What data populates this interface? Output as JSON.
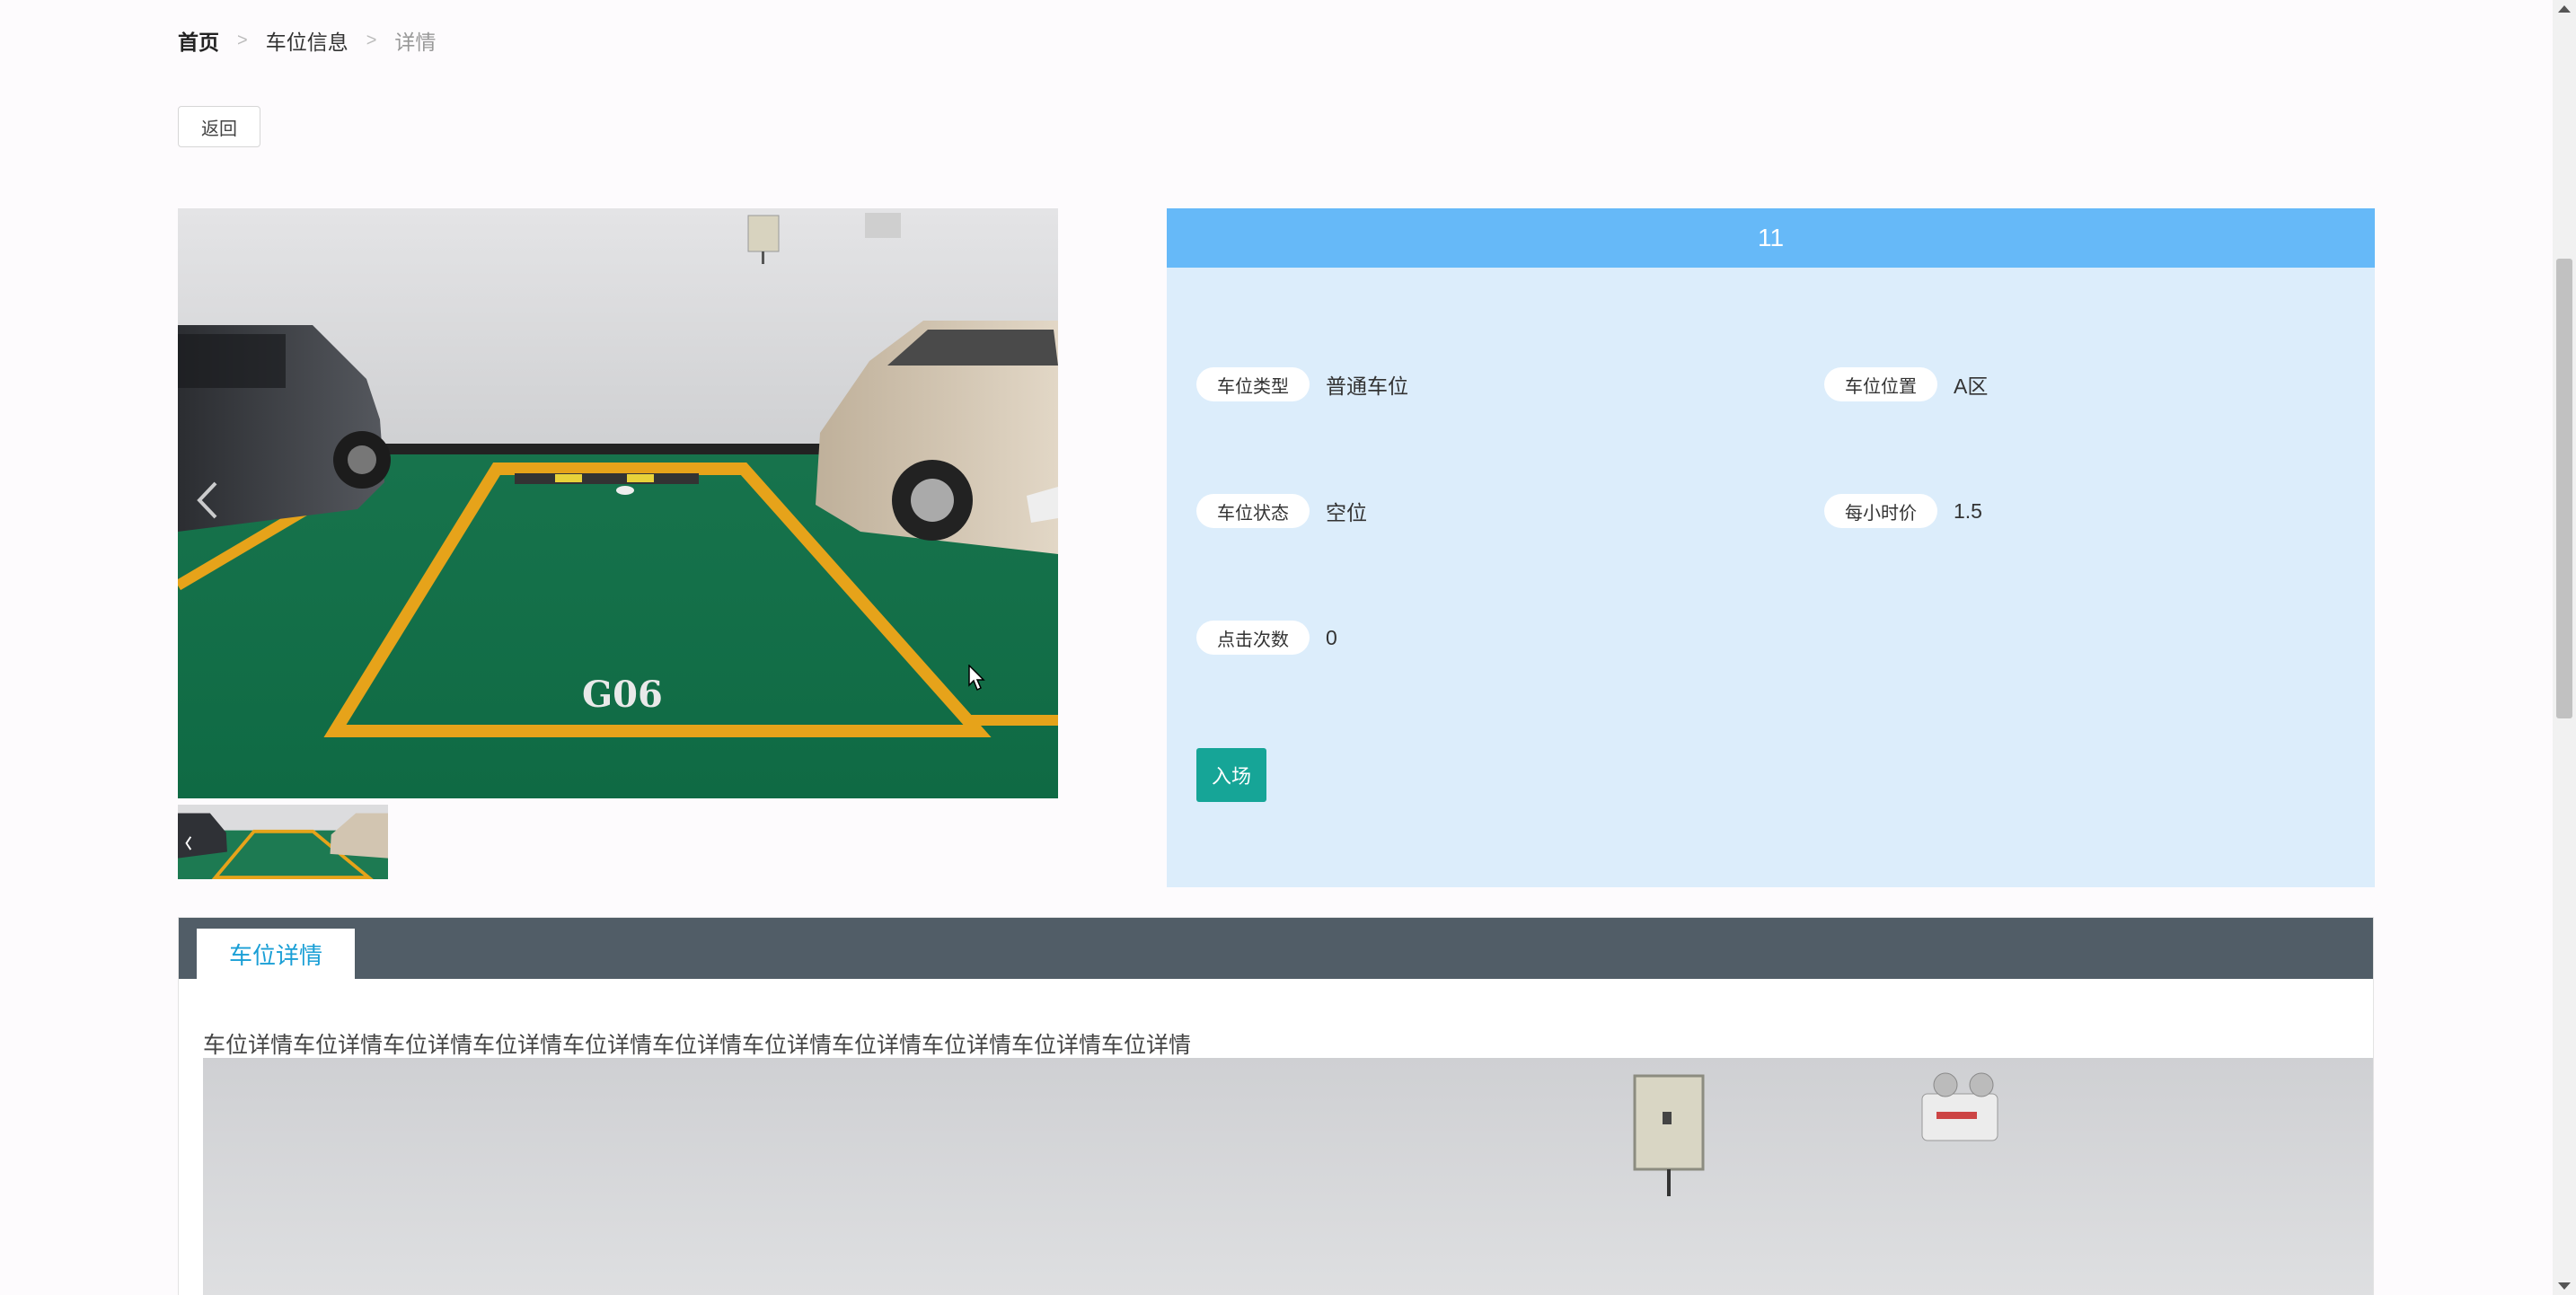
{
  "breadcrumb": {
    "home": "首页",
    "section": "车位信息",
    "current": "详情",
    "separator": ">"
  },
  "toolbar": {
    "back_label": "返回"
  },
  "gallery": {
    "main_image": "parking-space-photo",
    "thumbnail_image": "parking-space-thumbnail",
    "space_marking": "G06"
  },
  "info": {
    "title": "11",
    "fields": [
      {
        "label": "车位类型",
        "value": "普通车位"
      },
      {
        "label": "车位位置",
        "value": "A区"
      },
      {
        "label": "车位状态",
        "value": "空位"
      },
      {
        "label": "每小时价",
        "value": "1.5"
      },
      {
        "label": "点击次数",
        "value": "0"
      }
    ],
    "enter_label": "入场"
  },
  "details": {
    "tab_label": "车位详情",
    "text": "车位详情车位详情车位详情车位详情车位详情车位详情车位详情车位详情车位详情车位详情车位详情"
  },
  "colors": {
    "header_blue": "#66b9f8",
    "panel_bg": "#dcedfb",
    "enter_button": "#16a597",
    "tab_bar": "#515d67",
    "tab_text": "#1a9fd6"
  }
}
